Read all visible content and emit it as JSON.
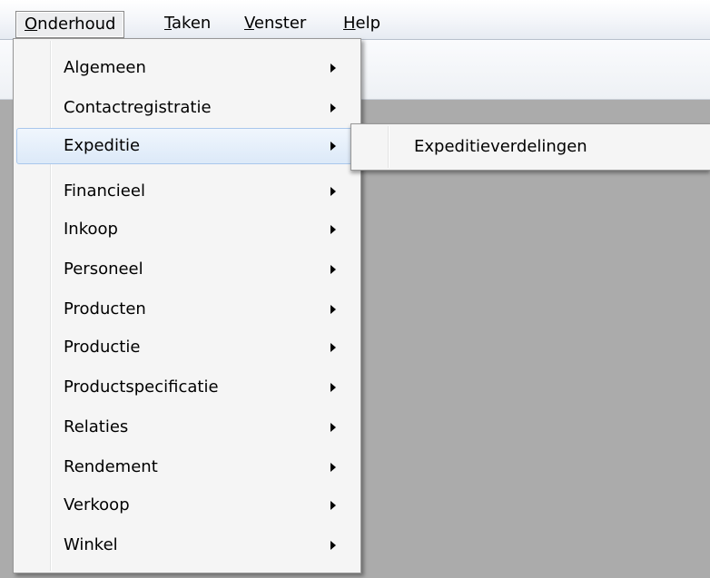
{
  "menubar": {
    "items": [
      {
        "mnemonic": "O",
        "rest": "nderhoud"
      },
      {
        "mnemonic": "T",
        "rest": "aken"
      },
      {
        "mnemonic": "V",
        "rest": "enster"
      },
      {
        "mnemonic": "H",
        "rest": "elp"
      }
    ]
  },
  "dropdown": {
    "items": [
      {
        "label": "Algemeen"
      },
      {
        "label": "Contactregistratie"
      },
      {
        "label": "Expeditie"
      },
      {
        "label": "Financieel"
      },
      {
        "label": "Inkoop"
      },
      {
        "label": "Personeel"
      },
      {
        "label": "Producten"
      },
      {
        "label": "Productie"
      },
      {
        "label": "Productspecificatie"
      },
      {
        "label": "Relaties"
      },
      {
        "label": "Rendement"
      },
      {
        "label": "Verkoop"
      },
      {
        "label": "Winkel"
      }
    ]
  },
  "submenu": {
    "items": [
      {
        "label": "Expeditieverdelingen"
      }
    ]
  }
}
